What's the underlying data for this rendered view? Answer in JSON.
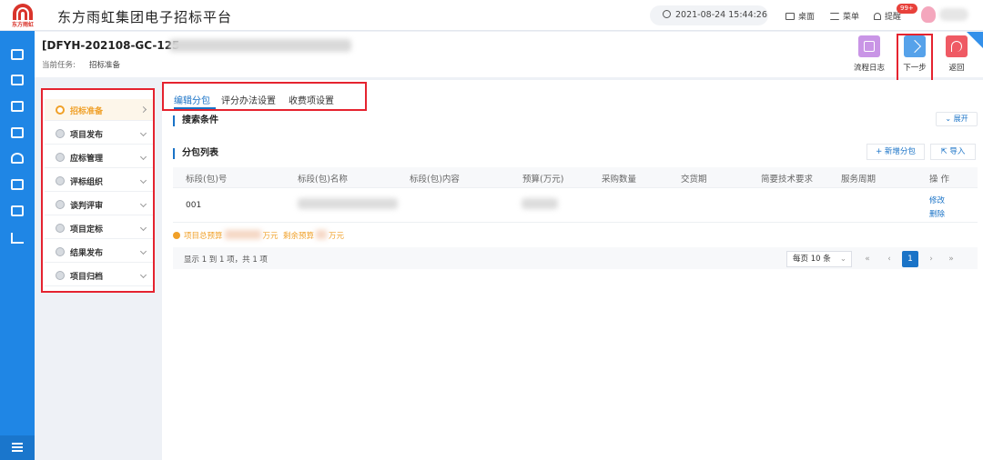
{
  "header": {
    "logo_text": "东方雨虹",
    "app_title": "东方雨虹集团电子招标平台",
    "datetime": "2021-08-24 15:44:26",
    "desktop_label": "桌面",
    "menu_label": "菜单",
    "notify_label": "提醒",
    "notify_badge": "99+"
  },
  "title_bar": {
    "project_code": "[DFYH-202108-GC-125",
    "task_label": "当前任务:",
    "task_value": "招标准备",
    "actions": {
      "log": "流程日志",
      "next": "下一步",
      "back": "返回"
    }
  },
  "steps": [
    {
      "label": "招标准备",
      "active": true
    },
    {
      "label": "项目发布"
    },
    {
      "label": "应标管理"
    },
    {
      "label": "评标组织"
    },
    {
      "label": "谈判评审"
    },
    {
      "label": "项目定标"
    },
    {
      "label": "结果发布"
    },
    {
      "label": "项目归档"
    }
  ],
  "tabs": [
    "编辑分包",
    "评分办法设置",
    "收费项设置"
  ],
  "search": {
    "title": "搜索条件",
    "expand": "展开"
  },
  "package_list": {
    "title": "分包列表",
    "add_button": "新增分包",
    "import_button": "导入",
    "columns": [
      "标段(包)号",
      "标段(包)名称",
      "标段(包)内容",
      "预算(万元)",
      "采购数量",
      "交货期",
      "简要技术要求",
      "服务周期",
      "操 作"
    ],
    "rows": [
      {
        "number": "001",
        "edit": "修改",
        "delete": "删除"
      }
    ],
    "budget_prefix": "项目总预算",
    "budget_unit": "万元",
    "budget_remaining": "剩余预算",
    "budget_unit2": "万元"
  },
  "pagination": {
    "summary": "显示 1 到 1 项，共 1 项",
    "per_page": "每页 10 条",
    "first": "«",
    "prev": "‹",
    "current": "1",
    "next": "›",
    "last": "»"
  }
}
